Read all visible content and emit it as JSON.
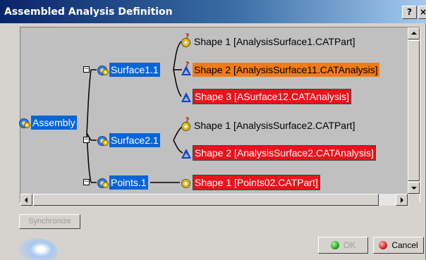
{
  "window": {
    "title": "Assembled Analysis Definition",
    "help_label": "?",
    "close_label": "×"
  },
  "tree": {
    "root": {
      "label": "Assembly"
    },
    "surface1": {
      "label": "Surface1.1",
      "children": [
        {
          "label": "Shape 1 [AnalysisSurface1.CATPart]",
          "state": "normal"
        },
        {
          "label": "Shape 2 [AnalysisSurface11.CATAnalysis]",
          "state": "orange"
        },
        {
          "label": "Shape 3 [ASurface12.CATAnalysis]",
          "state": "red"
        }
      ]
    },
    "surface2": {
      "label": "Surface2.1",
      "children": [
        {
          "label": "Shape 1 [AnalysisSurface2.CATPart]",
          "state": "normal"
        },
        {
          "label": "Shape 2 [AnalysisSurface2.CATAnalysis]",
          "state": "red"
        }
      ]
    },
    "points": {
      "label": "Points.1",
      "children": [
        {
          "label": "Shape 1 [Points02.CATPart]",
          "state": "red"
        }
      ]
    }
  },
  "buttons": {
    "synchronize": "Synchronize",
    "ok": "OK",
    "cancel": "Cancel"
  },
  "colors": {
    "selection_blue": "#0a64d8",
    "warning_orange": "#f07c16",
    "error_red": "#e8141b"
  }
}
